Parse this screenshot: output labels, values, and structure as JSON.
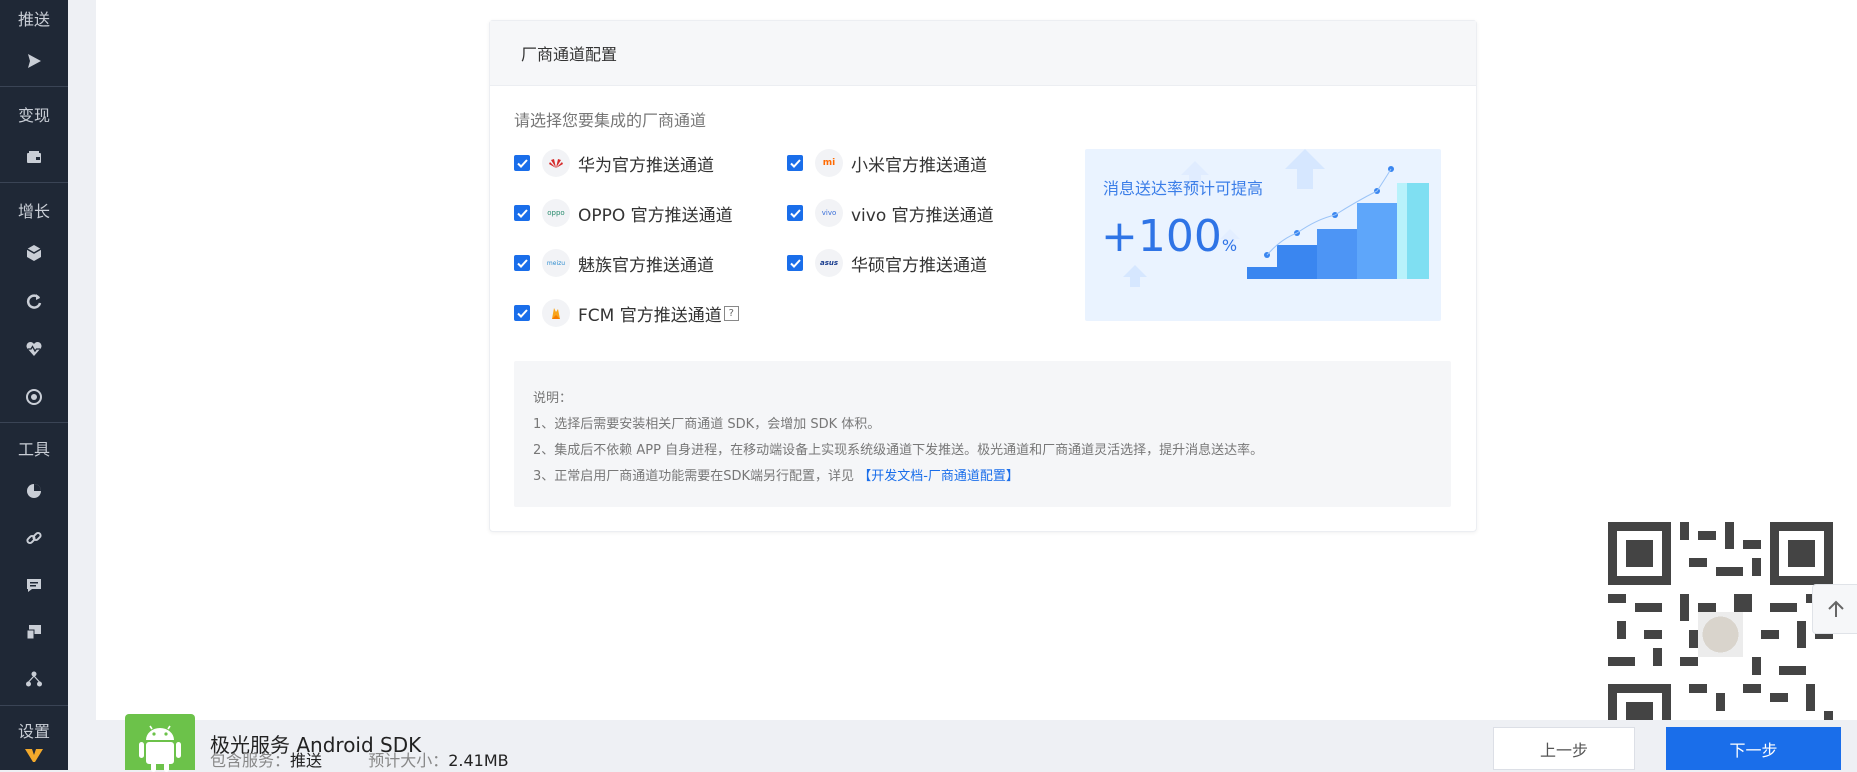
{
  "sidebar": {
    "sections": [
      "推送",
      "变现",
      "增长",
      "工具",
      "设置"
    ],
    "icons": [
      "play-icon",
      "wallet-icon",
      "cube-icon",
      "refresh-icon",
      "heart-pulse-icon",
      "target-icon",
      "pie-chart-icon",
      "link-icon",
      "chat-icon",
      "device-icon",
      "network-icon"
    ]
  },
  "card": {
    "title": "厂商通道配置",
    "subtitle": "请选择您要集成的厂商通道",
    "channels": [
      {
        "label": "华为官方推送通道",
        "brand": "huawei-logo-icon",
        "checked": true
      },
      {
        "label": "小米官方推送通道",
        "brand": "xiaomi-logo-icon",
        "checked": true
      },
      {
        "label": "OPPO 官方推送通道",
        "brand": "oppo-logo-icon",
        "checked": true
      },
      {
        "label": "vivo 官方推送通道",
        "brand": "vivo-logo-icon",
        "checked": true
      },
      {
        "label": "魅族官方推送通道",
        "brand": "meizu-logo-icon",
        "checked": true
      },
      {
        "label": "华硕官方推送通道",
        "brand": "asus-logo-icon",
        "checked": true
      },
      {
        "label": "FCM 官方推送通道",
        "brand": "fcm-logo-icon",
        "checked": true
      }
    ],
    "promo": {
      "text": "消息送达率预计可提高",
      "value": "+100",
      "unit": "%"
    },
    "notes": {
      "title": "说明：",
      "line1": "1、选择后需要安装相关厂商通道 SDK，会增加 SDK 体积。",
      "line2": "2、集成后不依赖 APP 自身进程，在移动端设备上实现系统级通道下发推送。极光通道和厂商通道灵活选择，提升消息送达率。",
      "line3_prefix": "3、正常启用厂商通道功能需要在SDK端另行配置，详见 ",
      "line3_link": "【开发文档-厂商通道配置】"
    }
  },
  "bottom": {
    "sdk_title": "极光服务 Android SDK",
    "services_label": "包含服务：",
    "services_value": "推送",
    "size_label": "预计大小：",
    "size_value": "2.41MB",
    "prev_label": "上一步",
    "next_label": "下一步"
  },
  "colors": {
    "sidebar_bg": "#1f2836",
    "accent": "#1a6eea",
    "android_green": "#6cc24a"
  }
}
